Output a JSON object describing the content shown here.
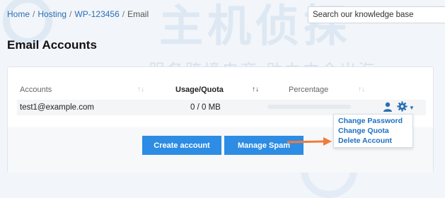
{
  "breadcrumb": {
    "home": "Home",
    "hosting": "Hosting",
    "plan": "WP-123456",
    "current": "Email",
    "separator": "/"
  },
  "search": {
    "placeholder": "Search our knowledge base"
  },
  "page_title": "Email Accounts",
  "watermark": {
    "big": "主机侦探",
    "sub": "服务跨境电商 助力中企出海"
  },
  "table": {
    "headers": {
      "accounts": "Accounts",
      "usage": "Usage/Quota",
      "percentage": "Percentage"
    },
    "rows": [
      {
        "account": "test1@example.com",
        "usage": "0 / 0 MB",
        "percentage": 0
      }
    ]
  },
  "actions": {
    "create": "Create account",
    "spam": "Manage Spam"
  },
  "menu": {
    "items": [
      "Change Password",
      "Change Quota",
      "Delete Account"
    ]
  },
  "colors": {
    "accent": "#2d8ce3",
    "link": "#2a6fb5",
    "arrow": "#f07c3a"
  },
  "icons": [
    "user-icon",
    "gear-icon",
    "caret-down-icon",
    "sort-icon"
  ]
}
